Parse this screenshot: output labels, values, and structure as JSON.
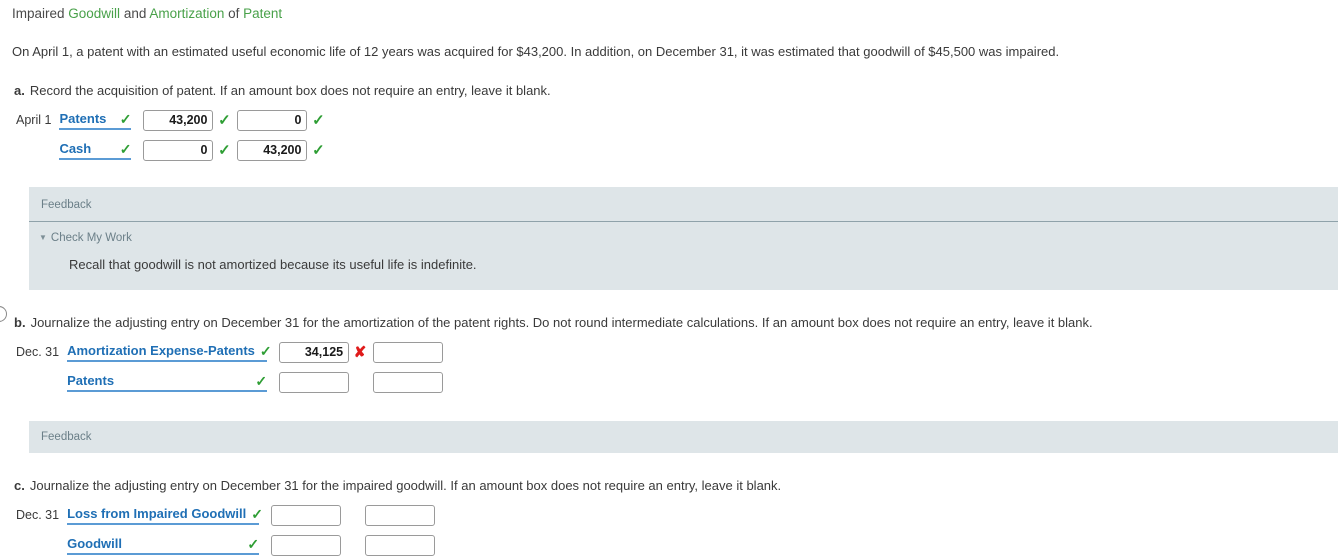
{
  "title": {
    "part1": "Impaired ",
    "kw1": "Goodwill",
    "part2": " and ",
    "kw2": "Amortization",
    "part3": " of ",
    "kw3": "Patent"
  },
  "problem_statement": "On April 1, a patent with an estimated useful economic life of 12 years was acquired for $43,200. In addition, on December 31, it was estimated that goodwill of $45,500 was impaired.",
  "colors": {
    "keyword_green": "#49a14a",
    "account_link_blue": "#1f6fb5",
    "account_underline": "#5b9bd5",
    "correct_green": "#2e9e34",
    "incorrect_red": "#e01b1b",
    "feedback_bg": "#dee5e8",
    "feedback_label": "#6b7f88"
  },
  "icons": {
    "correct": "✓",
    "incorrect": "✘",
    "caret_down": "▼"
  },
  "parts": [
    {
      "letter": "a.",
      "prompt": "Record the acquisition of patent. If an amount box does not require an entry, leave it blank.",
      "rows": [
        {
          "date": "April 1",
          "account": "Patents",
          "account_mark": "✓",
          "account_width": 72,
          "debit": "43,200",
          "debit_mark": "✓",
          "debit_status": "correct",
          "credit": "0",
          "credit_mark": "✓",
          "credit_status": "correct"
        },
        {
          "date": "",
          "account": "Cash",
          "account_mark": "✓",
          "account_width": 72,
          "debit": "0",
          "debit_mark": "✓",
          "debit_status": "correct",
          "credit": "43,200",
          "credit_mark": "✓",
          "credit_status": "correct"
        }
      ],
      "feedback": {
        "label": "Feedback",
        "expanded": true,
        "check_my_work": "Check My Work",
        "body": "Recall that goodwill is not amortized because its useful life is indefinite."
      }
    },
    {
      "letter": "b.",
      "prompt": "Journalize the adjusting entry on December 31 for the amortization of the patent rights. Do not round intermediate calculations. If an amount box does not require an entry, leave it blank.",
      "rows": [
        {
          "date": "Dec. 31",
          "account": "Amortization Expense-Patents",
          "account_mark": "✓",
          "account_width": 200,
          "debit": "34,125",
          "debit_mark": "✘",
          "debit_status": "incorrect",
          "credit": "",
          "credit_mark": "",
          "credit_status": "none"
        },
        {
          "date": "",
          "account": "Patents",
          "account_mark": "✓",
          "account_width": 200,
          "debit": "",
          "debit_mark": "",
          "debit_status": "none",
          "credit": "",
          "credit_mark": "",
          "credit_status": "none"
        }
      ],
      "feedback": {
        "label": "Feedback",
        "expanded": false,
        "check_my_work": "",
        "body": ""
      }
    },
    {
      "letter": "c.",
      "prompt": "Journalize the adjusting entry on December 31 for the impaired goodwill. If an amount box does not require an entry, leave it blank.",
      "rows": [
        {
          "date": "Dec. 31",
          "account": "Loss from Impaired Goodwill",
          "account_mark": "✓",
          "account_width": 192,
          "debit": "",
          "debit_mark": "",
          "debit_status": "none",
          "credit": "",
          "credit_mark": "",
          "credit_status": "none"
        },
        {
          "date": "",
          "account": "Goodwill",
          "account_mark": "✓",
          "account_width": 192,
          "debit": "",
          "debit_mark": "",
          "debit_status": "none",
          "credit": "",
          "credit_mark": "",
          "credit_status": "none"
        }
      ],
      "feedback": null
    }
  ]
}
